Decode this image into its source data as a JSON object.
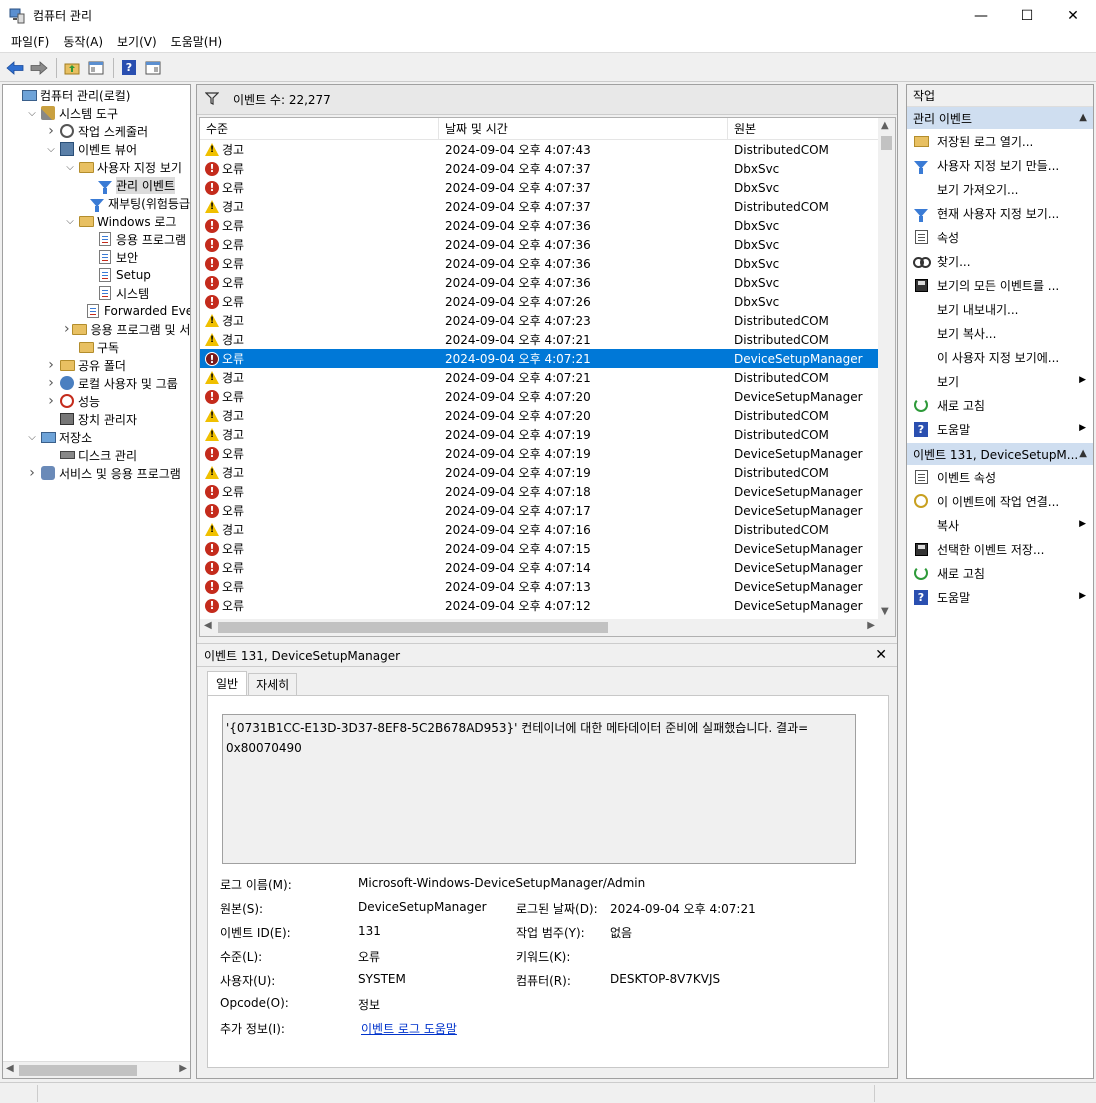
{
  "window": {
    "title": "컴퓨터 관리",
    "minimize": "—",
    "maximize": "☐",
    "close": "✕"
  },
  "menu": [
    "파일(F)",
    "동작(A)",
    "보기(V)",
    "도움말(H)"
  ],
  "tree": [
    {
      "label": "컴퓨터 관리(로컬)",
      "indent": 0,
      "expander": "",
      "icon": "computer-icon",
      "selected": false
    },
    {
      "label": "시스템 도구",
      "indent": 1,
      "expander": "open",
      "icon": "tools-icon",
      "selected": false
    },
    {
      "label": "작업 스케줄러",
      "indent": 2,
      "expander": "closed",
      "icon": "clock-icon",
      "selected": false
    },
    {
      "label": "이벤트 뷰어",
      "indent": 2,
      "expander": "open",
      "icon": "event-viewer-icon",
      "selected": false
    },
    {
      "label": "사용자 지정 보기",
      "indent": 3,
      "expander": "open",
      "icon": "folder-icon",
      "selected": false
    },
    {
      "label": "관리 이벤트",
      "indent": 4,
      "expander": "",
      "icon": "filter-icon",
      "selected": true
    },
    {
      "label": "재부팅(위험등급",
      "indent": 4,
      "expander": "",
      "icon": "filter-icon",
      "selected": false
    },
    {
      "label": "Windows 로그",
      "indent": 3,
      "expander": "open",
      "icon": "folder-icon",
      "selected": false
    },
    {
      "label": "응용 프로그램",
      "indent": 4,
      "expander": "",
      "icon": "log-icon",
      "selected": false
    },
    {
      "label": "보안",
      "indent": 4,
      "expander": "",
      "icon": "log-icon",
      "selected": false
    },
    {
      "label": "Setup",
      "indent": 4,
      "expander": "",
      "icon": "log-icon",
      "selected": false
    },
    {
      "label": "시스템",
      "indent": 4,
      "expander": "",
      "icon": "log-icon",
      "selected": false
    },
    {
      "label": "Forwarded Even",
      "indent": 4,
      "expander": "",
      "icon": "log-icon",
      "selected": false
    },
    {
      "label": "응용 프로그램 및 서",
      "indent": 3,
      "expander": "closed",
      "icon": "folder-icon",
      "selected": false
    },
    {
      "label": "구독",
      "indent": 3,
      "expander": "",
      "icon": "folder-icon",
      "selected": false
    },
    {
      "label": "공유 폴더",
      "indent": 2,
      "expander": "closed",
      "icon": "folder-icon",
      "selected": false
    },
    {
      "label": "로컬 사용자 및 그룹",
      "indent": 2,
      "expander": "closed",
      "icon": "users-icon",
      "selected": false
    },
    {
      "label": "성능",
      "indent": 2,
      "expander": "closed",
      "icon": "performance-icon",
      "selected": false
    },
    {
      "label": "장치 관리자",
      "indent": 2,
      "expander": "",
      "icon": "device-manager-icon",
      "selected": false
    },
    {
      "label": "저장소",
      "indent": 1,
      "expander": "open",
      "icon": "storage-icon",
      "selected": false
    },
    {
      "label": "디스크 관리",
      "indent": 2,
      "expander": "",
      "icon": "disk-icon",
      "selected": false
    },
    {
      "label": "서비스 및 응용 프로그램",
      "indent": 1,
      "expander": "closed",
      "icon": "services-icon",
      "selected": false
    }
  ],
  "center": {
    "event_count": "이벤트 수: 22,277",
    "columns": [
      "수준",
      "날짜 및 시간",
      "원본"
    ],
    "rows": [
      {
        "level": "경고",
        "type": "warning",
        "date": "2024-09-04 오후 4:07:43",
        "source": "DistributedCOM"
      },
      {
        "level": "오류",
        "type": "error",
        "date": "2024-09-04 오후 4:07:37",
        "source": "DbxSvc"
      },
      {
        "level": "오류",
        "type": "error",
        "date": "2024-09-04 오후 4:07:37",
        "source": "DbxSvc"
      },
      {
        "level": "경고",
        "type": "warning",
        "date": "2024-09-04 오후 4:07:37",
        "source": "DistributedCOM"
      },
      {
        "level": "오류",
        "type": "error",
        "date": "2024-09-04 오후 4:07:36",
        "source": "DbxSvc"
      },
      {
        "level": "오류",
        "type": "error",
        "date": "2024-09-04 오후 4:07:36",
        "source": "DbxSvc"
      },
      {
        "level": "오류",
        "type": "error",
        "date": "2024-09-04 오후 4:07:36",
        "source": "DbxSvc"
      },
      {
        "level": "오류",
        "type": "error",
        "date": "2024-09-04 오후 4:07:36",
        "source": "DbxSvc"
      },
      {
        "level": "오류",
        "type": "error",
        "date": "2024-09-04 오후 4:07:26",
        "source": "DbxSvc"
      },
      {
        "level": "경고",
        "type": "warning",
        "date": "2024-09-04 오후 4:07:23",
        "source": "DistributedCOM"
      },
      {
        "level": "경고",
        "type": "warning",
        "date": "2024-09-04 오후 4:07:21",
        "source": "DistributedCOM"
      },
      {
        "level": "오류",
        "type": "error",
        "date": "2024-09-04 오후 4:07:21",
        "source": "DeviceSetupManager",
        "selected": true
      },
      {
        "level": "경고",
        "type": "warning",
        "date": "2024-09-04 오후 4:07:21",
        "source": "DistributedCOM"
      },
      {
        "level": "오류",
        "type": "error",
        "date": "2024-09-04 오후 4:07:20",
        "source": "DeviceSetupManager"
      },
      {
        "level": "경고",
        "type": "warning",
        "date": "2024-09-04 오후 4:07:20",
        "source": "DistributedCOM"
      },
      {
        "level": "경고",
        "type": "warning",
        "date": "2024-09-04 오후 4:07:19",
        "source": "DistributedCOM"
      },
      {
        "level": "오류",
        "type": "error",
        "date": "2024-09-04 오후 4:07:19",
        "source": "DeviceSetupManager"
      },
      {
        "level": "경고",
        "type": "warning",
        "date": "2024-09-04 오후 4:07:19",
        "source": "DistributedCOM"
      },
      {
        "level": "오류",
        "type": "error",
        "date": "2024-09-04 오후 4:07:18",
        "source": "DeviceSetupManager"
      },
      {
        "level": "오류",
        "type": "error",
        "date": "2024-09-04 오후 4:07:17",
        "source": "DeviceSetupManager"
      },
      {
        "level": "경고",
        "type": "warning",
        "date": "2024-09-04 오후 4:07:16",
        "source": "DistributedCOM"
      },
      {
        "level": "오류",
        "type": "error",
        "date": "2024-09-04 오후 4:07:15",
        "source": "DeviceSetupManager"
      },
      {
        "level": "오류",
        "type": "error",
        "date": "2024-09-04 오후 4:07:14",
        "source": "DeviceSetupManager"
      },
      {
        "level": "오류",
        "type": "error",
        "date": "2024-09-04 오후 4:07:13",
        "source": "DeviceSetupManager"
      },
      {
        "level": "오류",
        "type": "error",
        "date": "2024-09-04 오후 4:07:12",
        "source": "DeviceSetupManager"
      }
    ]
  },
  "detail": {
    "title": "이벤트 131, DeviceSetupManager",
    "close": "✕",
    "tabs": [
      "일반",
      "자세히"
    ],
    "description_line1": "'{0731B1CC-E13D-3D37-8EF8-5C2B678AD953}' 컨테이너에 대한 메타데이터 준비에 실패했습니다. 결과=",
    "description_line2": "0x80070490",
    "labels": {
      "log_name": "로그 이름(M):",
      "source": "원본(S):",
      "event_id": "이벤트 ID(E):",
      "level": "수준(L):",
      "user": "사용자(U):",
      "opcode": "Opcode(O):",
      "more_info": "추가 정보(I):",
      "logged": "로그된 날짜(D):",
      "task_category": "작업 범주(Y):",
      "keywords": "키워드(K):",
      "computer": "컴퓨터(R):"
    },
    "values": {
      "log_name": "Microsoft-Windows-DeviceSetupManager/Admin",
      "source": "DeviceSetupManager",
      "event_id": "131",
      "level": "오류",
      "user": "SYSTEM",
      "opcode": "정보",
      "more_info": "이벤트 로그 도움말",
      "logged": "2024-09-04 오후 4:07:21",
      "task_category": "없음",
      "keywords": "",
      "computer": "DESKTOP-8V7KVJS"
    }
  },
  "actions": {
    "title": "작업",
    "section1": "관리 이벤트",
    "items1": [
      {
        "label": "저장된 로그 열기...",
        "icon": "open-folder-icon",
        "submenu": false
      },
      {
        "label": "사용자 지정 보기 만들...",
        "icon": "filter-icon",
        "submenu": false
      },
      {
        "label": "보기 가져오기...",
        "icon": "",
        "submenu": false
      },
      {
        "label": "현재 사용자 지정 보기...",
        "icon": "filter-icon",
        "submenu": false
      },
      {
        "label": "속성",
        "icon": "properties-icon",
        "submenu": false
      },
      {
        "label": "찾기...",
        "icon": "find-icon",
        "submenu": false
      },
      {
        "label": "보기의 모든 이벤트를 ...",
        "icon": "save-icon",
        "submenu": false
      },
      {
        "label": "보기 내보내기...",
        "icon": "",
        "submenu": false
      },
      {
        "label": "보기 복사...",
        "icon": "",
        "submenu": false
      },
      {
        "label": "이 사용자 지정 보기에...",
        "icon": "",
        "submenu": false
      },
      {
        "label": "보기",
        "icon": "",
        "submenu": true
      },
      {
        "label": "새로 고침",
        "icon": "refresh-icon",
        "submenu": false
      },
      {
        "label": "도움말",
        "icon": "help-icon",
        "submenu": true
      }
    ],
    "section2": "이벤트 131, DeviceSetupM...",
    "items2": [
      {
        "label": "이벤트 속성",
        "icon": "properties-icon",
        "submenu": false
      },
      {
        "label": "이 이벤트에 작업 연결...",
        "icon": "attach-task-icon",
        "submenu": false
      },
      {
        "label": "복사",
        "icon": "",
        "submenu": true
      },
      {
        "label": "선택한 이벤트 저장...",
        "icon": "save-icon",
        "submenu": false
      },
      {
        "label": "새로 고침",
        "icon": "refresh-icon",
        "submenu": false
      },
      {
        "label": "도움말",
        "icon": "help-icon",
        "submenu": true
      }
    ]
  },
  "colors": {
    "selection": "#0078d7",
    "error": "#c42b1c",
    "warning": "#f0c000",
    "action_section": "#cfdef0",
    "link": "#0033cc"
  }
}
